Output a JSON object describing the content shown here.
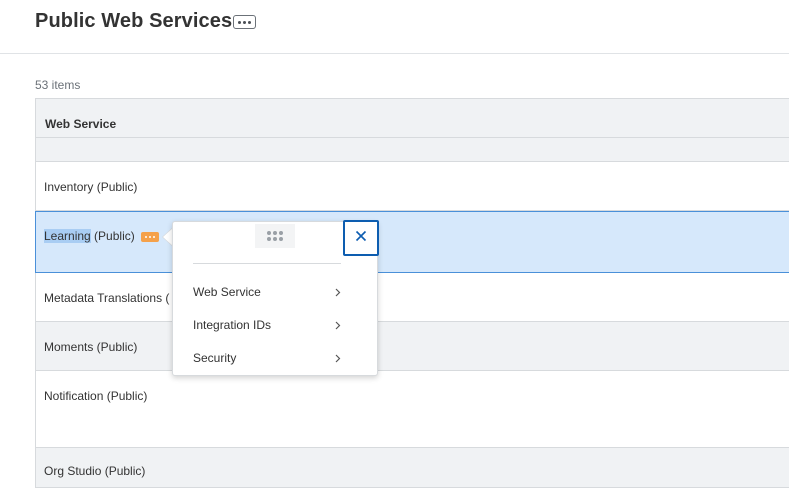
{
  "header": {
    "title": "Public Web Services",
    "more_icon": "ellipsis-icon"
  },
  "list": {
    "count_label": "53 items"
  },
  "table": {
    "column_header": "Web Service",
    "rows": [
      {
        "label": "Inventory (Public)"
      },
      {
        "label_highlight": "Learning",
        "label_rest": " (Public)",
        "selected": true
      },
      {
        "label": "Metadata Translations ("
      },
      {
        "label": "Moments (Public)"
      },
      {
        "label": "Notification (Public)"
      },
      {
        "label": "Org Studio (Public)"
      }
    ]
  },
  "popup": {
    "drag_icon": "drag-handle-icon",
    "menu": [
      {
        "label": "Web Service",
        "icon": "chevron-right-icon"
      },
      {
        "label": "Integration IDs",
        "icon": "chevron-right-icon"
      },
      {
        "label": "Security",
        "icon": "chevron-right-icon"
      }
    ],
    "close_icon": "close-icon"
  },
  "colors": {
    "accent": "#0d5db0",
    "selection": "#d6e8fb",
    "related_actions": "#f5a14a"
  }
}
